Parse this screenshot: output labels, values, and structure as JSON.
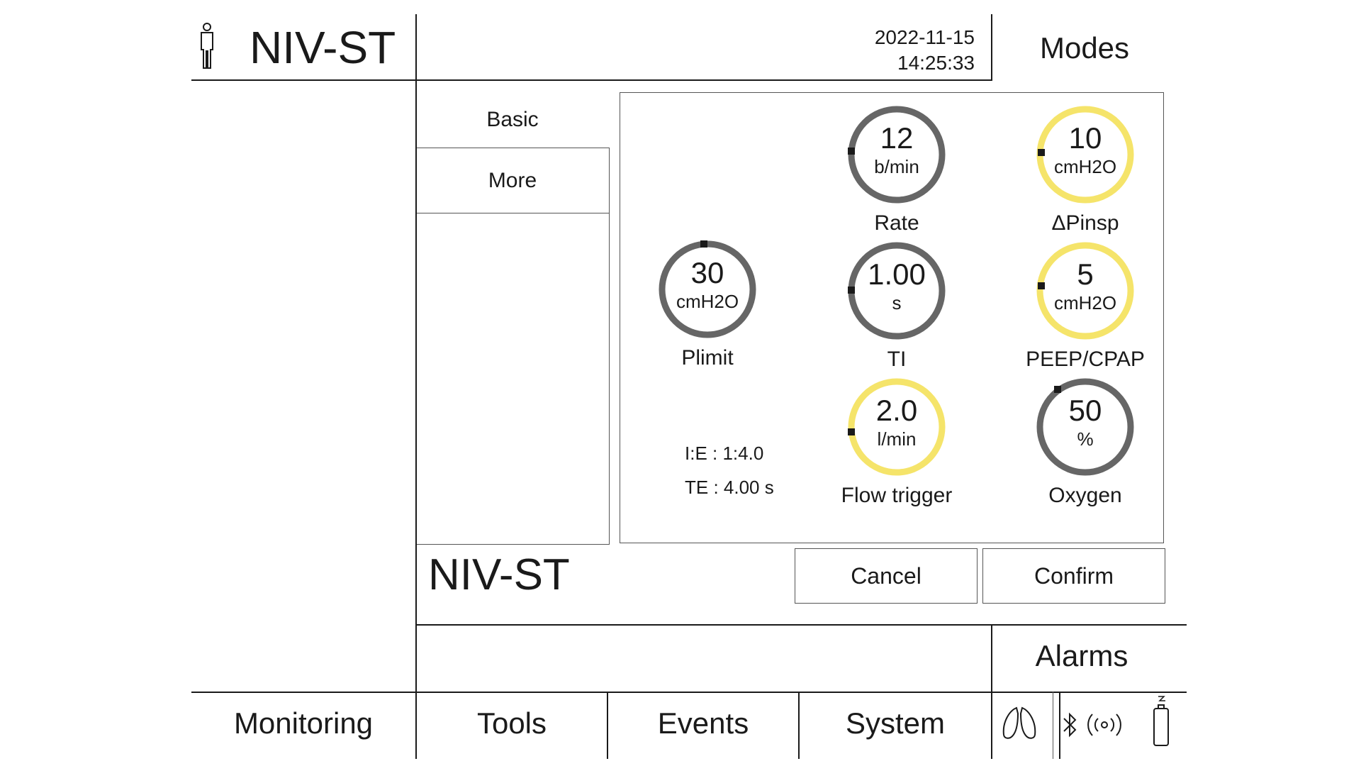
{
  "header": {
    "mode": "NIV-ST",
    "date": "2022-11-15",
    "time": "14:25:33",
    "modes_label": "Modes"
  },
  "tabs": [
    {
      "label": "Basic"
    },
    {
      "label": "More"
    }
  ],
  "settings": {
    "rate": {
      "value": "12",
      "unit": "b/min",
      "label": "Rate",
      "ring_color": "#666666"
    },
    "dpinsp": {
      "value": "10",
      "unit": "cmH2O",
      "label": "ΔPinsp",
      "ring_color": "#f5e46a"
    },
    "plimit": {
      "value": "30",
      "unit": "cmH2O",
      "label": "Plimit",
      "ring_color": "#666666"
    },
    "ti": {
      "value": "1.00",
      "unit": "s",
      "label": "TI",
      "ring_color": "#666666"
    },
    "peep": {
      "value": "5",
      "unit": "cmH2O",
      "label": "PEEP/CPAP",
      "ring_color": "#f5e46a"
    },
    "flow_trigger": {
      "value": "2.0",
      "unit": "l/min",
      "label": "Flow trigger",
      "ring_color": "#f5e46a"
    },
    "oxygen": {
      "value": "50",
      "unit": "%",
      "label": "Oxygen",
      "ring_color": "#666666"
    }
  },
  "ratios": {
    "ie": "I:E : 1:4.0",
    "te": "TE : 4.00 s"
  },
  "footer_mode": "NIV-ST",
  "actions": {
    "cancel": "Cancel",
    "confirm": "Confirm"
  },
  "alarms_label": "Alarms",
  "nav": [
    {
      "label": "Monitoring"
    },
    {
      "label": "Tools"
    },
    {
      "label": "Events"
    },
    {
      "label": "System"
    }
  ],
  "status_icons": [
    "lungs-icon",
    "bluetooth-icon",
    "wireless-signal-icon",
    "battery-charging-icon"
  ]
}
